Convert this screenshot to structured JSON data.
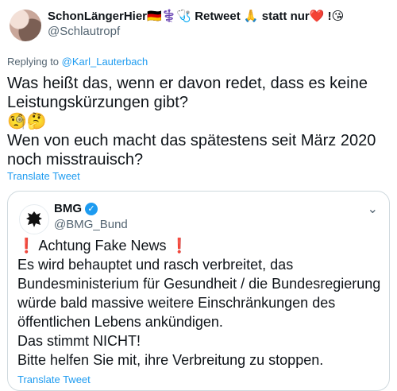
{
  "author": {
    "name": "SchonLängerHier🇩🇪⚕️🩺 Retweet 🙏 statt nur❤️ !😘",
    "handle": "@Schlautropf"
  },
  "reply": {
    "prefix": "Replying to",
    "mention": "@Karl_Lauterbach"
  },
  "tweet": {
    "lines": [
      "Was heißt das, wenn er davon redet, dass es keine Leistungskürzungen gibt?",
      "🧐🤔",
      "Wen von euch macht das spätestens seit März 2020 noch misstrauisch?"
    ],
    "translate_label": "Translate Tweet"
  },
  "quote": {
    "name": "BMG",
    "handle": "@BMG_Bund",
    "lines": [
      "❗ Achtung Fake News ❗",
      "Es wird behauptet und rasch verbreitet, das Bundesministerium für Gesundheit / die Bundesregierung würde bald massive weitere Einschränkungen des öffentlichen Lebens ankündigen.",
      "Das stimmt NICHT!",
      "Bitte helfen Sie mit, ihre Verbreitung zu stoppen."
    ],
    "translate_label": "Translate Tweet"
  },
  "icons": {
    "verified": "verified-badge-icon",
    "caret": "chevron-down-icon",
    "eagle": "federal-eagle-icon"
  },
  "colors": {
    "link": "#1d9bf0",
    "muted": "#536471",
    "text": "#0f1419",
    "border": "#cfd9de"
  }
}
